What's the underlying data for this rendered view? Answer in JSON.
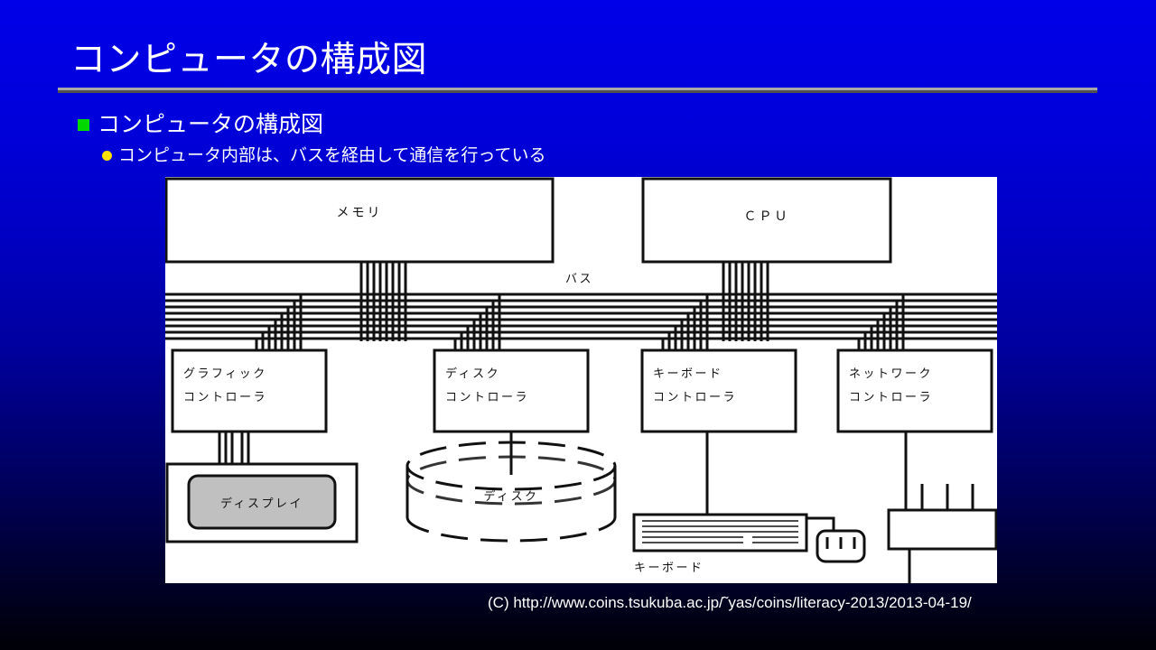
{
  "slide": {
    "title": "コンピュータの構成図",
    "background_top_color": "#0000e8",
    "background_bottom_color": "#000006",
    "rule_light_color": "#a8a8a8",
    "rule_dark_color": "#505050"
  },
  "bullets": {
    "level1": {
      "marker": "green-square-bullet",
      "marker_color": "#00d800",
      "text": "コンピュータの構成図"
    },
    "level2": {
      "marker": "yellow-dot-bullet",
      "marker_color": "#ffe000",
      "text": "コンピュータ内部は、バスを経由して通信を行っている"
    }
  },
  "diagram": {
    "bus_label": "バス",
    "top_boxes": [
      {
        "id": "memory",
        "label": "メモリ"
      },
      {
        "id": "cpu",
        "label": "ＣＰＵ"
      }
    ],
    "controllers": [
      {
        "id": "graphics-controller",
        "line1": "グラフィック",
        "line2": "コントローラ"
      },
      {
        "id": "disk-controller",
        "line1": "ディスク",
        "line2": "コントローラ"
      },
      {
        "id": "keyboard-controller",
        "line1": "キーボード",
        "line2": "コントローラ"
      },
      {
        "id": "network-controller",
        "line1": "ネットワーク",
        "line2": "コントローラ"
      }
    ],
    "devices": [
      {
        "id": "display",
        "label": "ディスプレイ",
        "fill": "#c0c0c0"
      },
      {
        "id": "disk",
        "label": "ディスク",
        "shape": "cylinder"
      },
      {
        "id": "keyboard",
        "label": "キーボード",
        "shape": "keyboard"
      },
      {
        "id": "mouse",
        "label": "",
        "shape": "mouse",
        "buttons": 3
      },
      {
        "id": "network-hub",
        "label": "",
        "shape": "hub",
        "ports": 4
      }
    ]
  },
  "footer": {
    "credit": "(C) http://www.coins.tsukuba.ac.jp/˜yas/coins/literacy-2013/2013-04-19/"
  }
}
